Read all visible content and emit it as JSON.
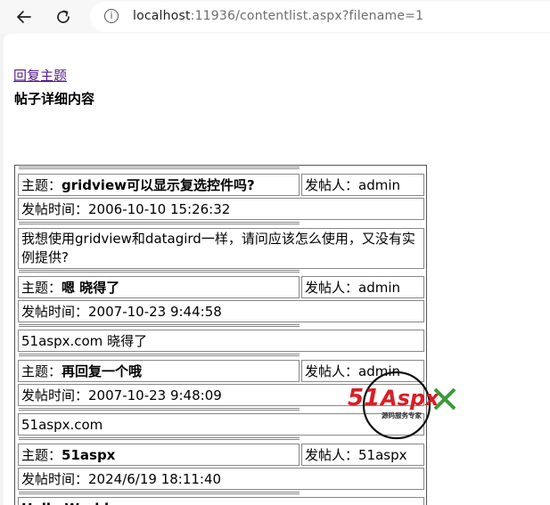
{
  "browser": {
    "url_host": "localhost",
    "url_rest": ":11936/contentlist.aspx?filename=1"
  },
  "page": {
    "reply_link": "回复主题",
    "title": "帖子详细内容"
  },
  "labels": {
    "subject": "主题：",
    "poster": "发帖人：",
    "post_time": "发帖时间："
  },
  "posts": [
    {
      "subject": "gridview可以显示复选控件吗?",
      "poster": "admin",
      "time": "2006-10-10 15:26:32",
      "content": "我想使用gridview和datagird一样，请问应该怎么使用，又没有实例提供?"
    },
    {
      "subject": "嗯 晓得了",
      "poster": "admin",
      "time": "2007-10-23 9:44:58",
      "content": "51aspx.com 晓得了"
    },
    {
      "subject": "再回复一个哦",
      "poster": "admin",
      "time": "2007-10-23 9:48:09",
      "content": "51aspx.com"
    },
    {
      "subject": "51aspx",
      "poster": "51aspx",
      "time": "2024/6/19 18:11:40",
      "content": "Hello World"
    }
  ],
  "watermark": {
    "brand_51": "51",
    "brand_aspx": "Aspx",
    "tagline": "源码服务专家"
  },
  "colors": {
    "link": "#551a8b",
    "watermark_red": "#d71f26",
    "watermark_green": "#3a9a3a"
  }
}
